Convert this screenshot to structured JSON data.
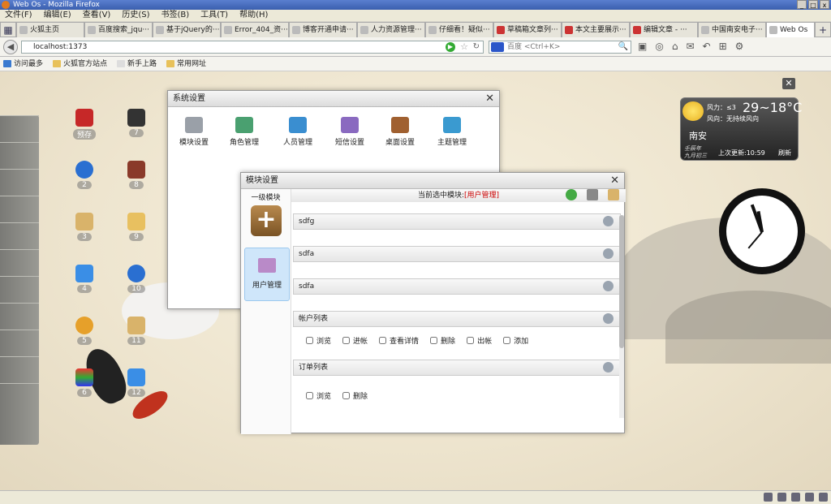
{
  "browser": {
    "title": "Web Os - Mozilla Firefox",
    "menu": [
      "文件(F)",
      "编辑(E)",
      "查看(V)",
      "历史(S)",
      "书签(B)",
      "工具(T)",
      "帮助(H)"
    ],
    "tabs": [
      "火狐主页",
      "百度搜索_jqu···",
      "基于jQuery的···",
      "Error_404_资···",
      "博客开通申请···",
      "人力资源管理···",
      "仔细看！疑似···",
      "草稿箱文章列···",
      "本文主要展示···",
      "编辑文章 - ···",
      "中国南安电子···",
      "Web Os"
    ],
    "new_tab": "+",
    "url": "localhost:1373",
    "search_placeholder": "百度 <Ctrl+K>",
    "bookmarks": [
      "访问最多",
      "火狐官方站点",
      "新手上路",
      "常用网址"
    ]
  },
  "desktop": {
    "icons": [
      {
        "label": "预存",
        "color": "#c62828"
      },
      {
        "label": "2",
        "color": "#2a6fd1"
      },
      {
        "label": "3",
        "color": "#d9b36a"
      },
      {
        "label": "4",
        "color": "#3a8ee6"
      },
      {
        "label": "5",
        "color": "#e6a02a"
      },
      {
        "label": "6",
        "color": "#8e44ad"
      },
      {
        "label": "7",
        "color": "#333333"
      },
      {
        "label": "8",
        "color": "#8a3a2a"
      },
      {
        "label": "9",
        "color": "#e8c060"
      },
      {
        "label": "10",
        "color": "#2a6fd1"
      },
      {
        "label": "11",
        "color": "#d9b36a"
      },
      {
        "label": "12",
        "color": "#3a8ee6"
      }
    ],
    "icon_texts": {
      "pic": "图片\n故事"
    },
    "close_label": "✕"
  },
  "weather": {
    "wind": "风力：≤3",
    "wind_dir": "风向：无持续风向",
    "temp": "29~18°C",
    "city": "南安",
    "lunar1": "壬辰年",
    "lunar2": "九月初三",
    "updated": "上次更新:10:59",
    "refresh": "刷新"
  },
  "sysWin": {
    "title": "系统设置",
    "items": [
      {
        "label": "模块设置",
        "color": "#9aa0a8"
      },
      {
        "label": "角色管理",
        "color": "#4aa070"
      },
      {
        "label": "人员管理",
        "color": "#3a8ed0"
      },
      {
        "label": "短信设置",
        "color": "#8a6ac0"
      },
      {
        "label": "桌面设置",
        "color": "#a06030"
      },
      {
        "label": "主题管理",
        "color": "#3a9ad0"
      }
    ]
  },
  "modWin": {
    "title": "模块设置",
    "left_title": "一级模块",
    "add": "+",
    "user_item": "用户管理",
    "current_prefix": "当前选中模块:",
    "current": "[用户管理]",
    "rows": [
      "sdfg",
      "sdfa",
      "sdfa",
      "帐户列表",
      "订单列表"
    ],
    "perm1": [
      "浏览",
      "进帐",
      "查看详情",
      "删除",
      "出帐",
      "添加"
    ],
    "perm2": [
      "浏览",
      "删除"
    ]
  }
}
